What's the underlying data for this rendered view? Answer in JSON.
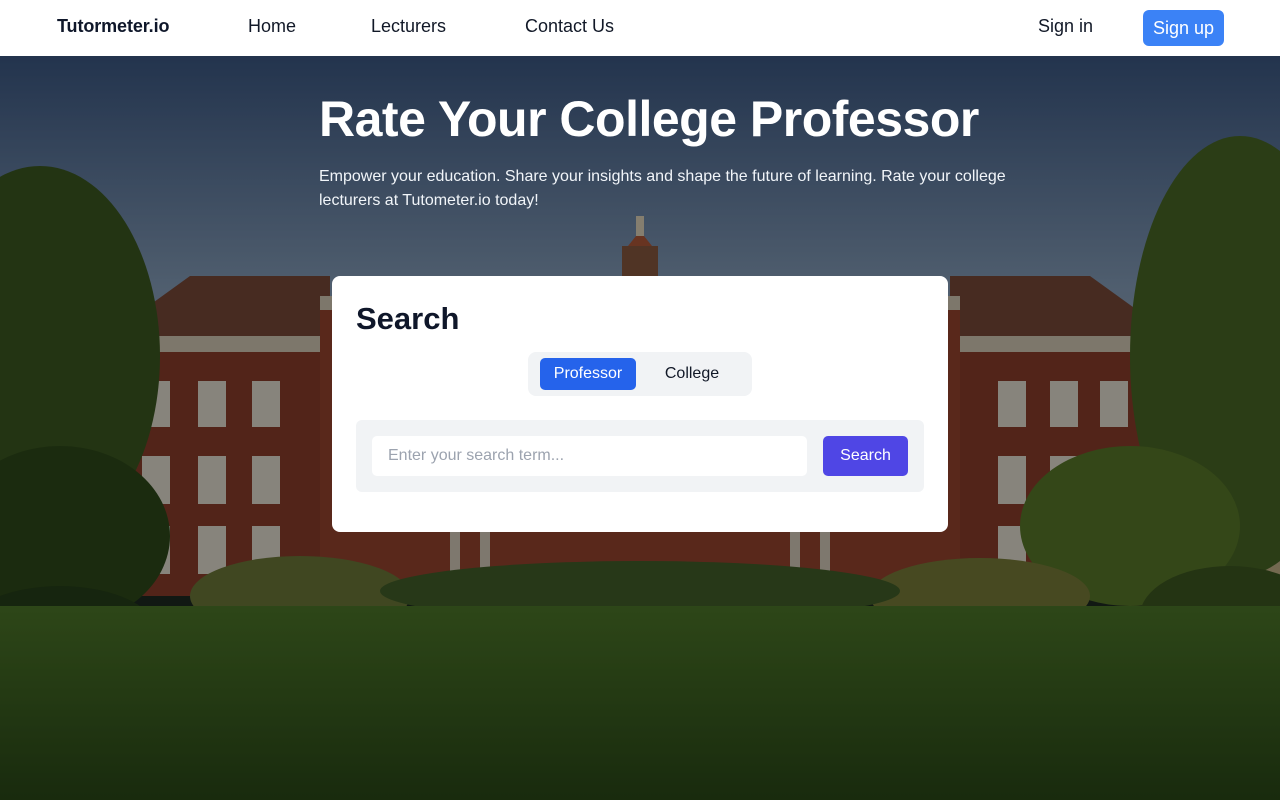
{
  "nav": {
    "brand": "Tutormeter.io",
    "links": [
      "Home",
      "Lecturers",
      "Contact Us"
    ],
    "sign_in": "Sign in",
    "sign_up": "Sign up"
  },
  "hero": {
    "title": "Rate Your College Professor",
    "subtitle": "Empower your education. Share your insights and shape the future of learning. Rate your college lecturers at Tutometer.io today!"
  },
  "search": {
    "heading": "Search",
    "toggle_options": [
      "Professor",
      "College"
    ],
    "selected_option": "Professor",
    "input_placeholder": "Enter your search term...",
    "input_value": "",
    "button_label": "Search"
  },
  "colors": {
    "signup_button": "#3b82f6",
    "toggle_active": "#2563eb",
    "search_button": "#4f46e5"
  }
}
